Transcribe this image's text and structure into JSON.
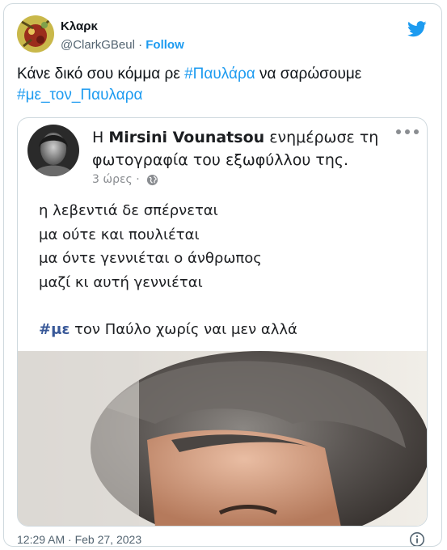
{
  "author": {
    "display_name": "Κλαρκ",
    "handle": "@ClarkGBeul",
    "separator": "·",
    "follow_label": "Follow"
  },
  "tweet": {
    "text_before": "Κάνε δικό σου κόμμα ρε ",
    "hashtag_1": "#Παυλάρα",
    "text_middle": " να σαρώσουμε",
    "hashtag_2": "#με_τον_Παυλαρα"
  },
  "embedded_post": {
    "header_prefix": "Η ",
    "author_name": "Mirsini Vounatsou",
    "header_suffix": " ενημέρωσε τη φωτογραφία του εξωφύλλου της.",
    "time": "3 ώρες",
    "time_separator": "·",
    "lines": [
      "η λεβεντιά δε σπέρνεται",
      "μα ούτε και πουλιέται",
      "μα όντε γεννιέται ο άνθρωπος",
      "μαζί κι αυτή γεννιέται"
    ],
    "tag_word": "#με",
    "tag_rest": " τον Παύλο χωρίς ναι μεν αλλά"
  },
  "footer": {
    "timestamp": "12:29 AM · Feb 27, 2023"
  },
  "colors": {
    "twitter_blue": "#1d9bf0",
    "facebook_tag": "#385898",
    "muted": "#536471"
  },
  "icons": [
    "twitter-bird-icon",
    "globe-icon",
    "more-dots-icon",
    "info-icon"
  ]
}
